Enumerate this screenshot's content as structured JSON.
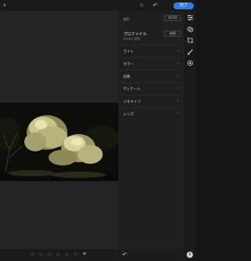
{
  "topbar": {
    "back_icon": "‹",
    "redo_icon": "↻",
    "undo_icon": "↶",
    "done_label": "完了"
  },
  "panel": {
    "section_label": "補助",
    "auto_label": "AUTO",
    "profile_title": "プロファイル",
    "profile_subtitle": "Adobe 標準",
    "browse_label": "参照",
    "rows": [
      {
        "label": "ライト"
      },
      {
        "label": "カラー"
      },
      {
        "label": "効果"
      },
      {
        "label": "ディテール"
      },
      {
        "label": "ジオメトリ"
      },
      {
        "label": "レンズ"
      }
    ]
  },
  "toolstrip": {
    "icons": [
      "sliders-icon",
      "presets-icon",
      "crop-icon",
      "brush-icon",
      "healing-icon"
    ]
  },
  "bottombar": {
    "rating": 0,
    "stars": [
      "☆",
      "☆",
      "☆",
      "☆",
      "☆"
    ],
    "flags": [
      "⚐",
      "⚑"
    ],
    "undo_icon": "↶",
    "info_icon": "i"
  },
  "colors": {
    "accent": "#2f7de1",
    "panel_bg": "#1f1f1f",
    "canvas_bg": "#242424"
  }
}
